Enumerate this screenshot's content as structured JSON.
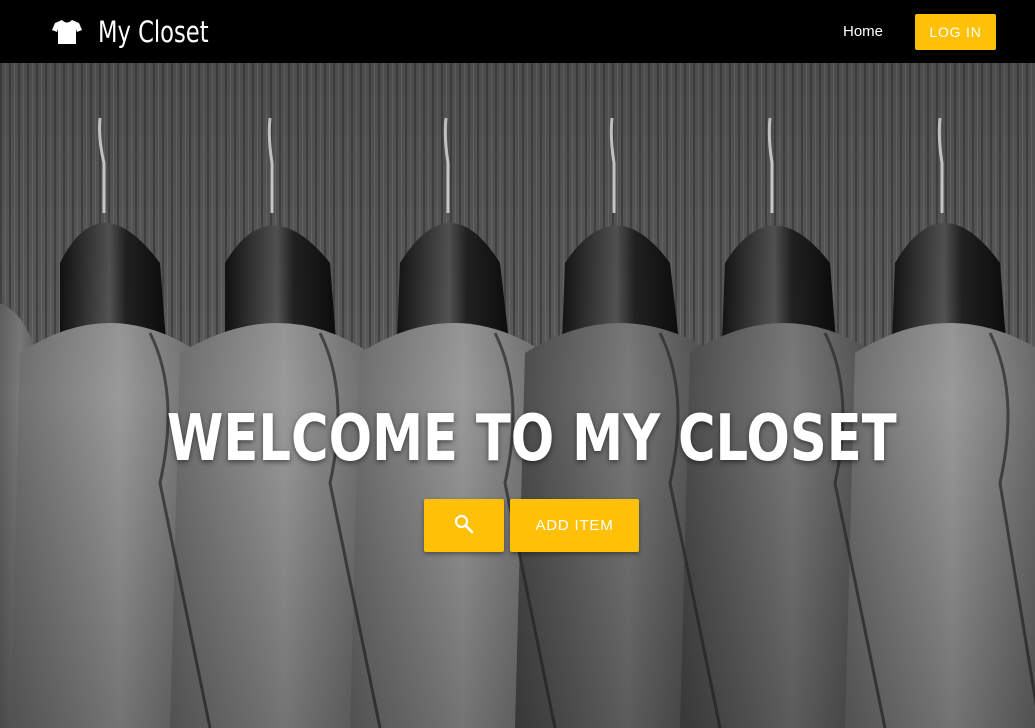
{
  "navbar": {
    "brand_title": "My Closet",
    "brand_icon": "tshirt-icon",
    "home_link": "Home",
    "login_button": "LOG IN"
  },
  "hero": {
    "title": "WELCOME TO MY CLOSET",
    "search_button_icon": "search-icon",
    "add_item_button": "ADD ITEM",
    "background_image": "suits-on-hangers-photo"
  },
  "colors": {
    "navbar_bg": "#000000",
    "accent": "#ffc107",
    "text_light": "#ffffff"
  }
}
